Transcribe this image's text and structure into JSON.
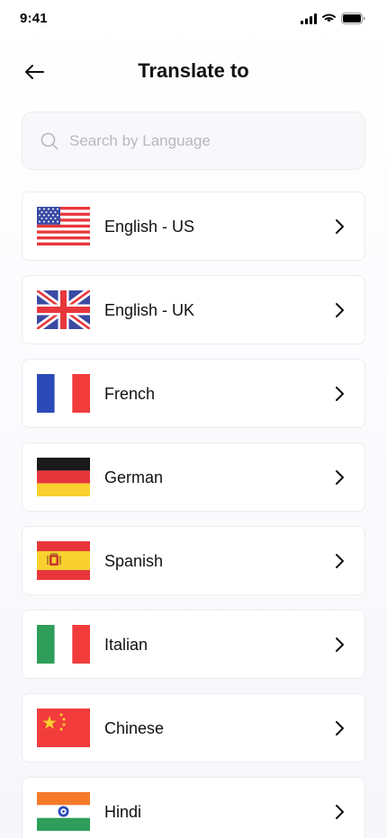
{
  "status_bar": {
    "time": "9:41",
    "icons": [
      "signal-icon",
      "wifi-icon",
      "battery-icon"
    ]
  },
  "header": {
    "title": "Translate to",
    "back_icon": "arrow-left-icon"
  },
  "search": {
    "placeholder": "Search by Language",
    "value": "",
    "icon": "search-icon"
  },
  "languages": [
    {
      "label": "English - US",
      "flag": "us-flag-icon"
    },
    {
      "label": "English - UK",
      "flag": "uk-flag-icon"
    },
    {
      "label": "French",
      "flag": "france-flag-icon"
    },
    {
      "label": "German",
      "flag": "germany-flag-icon"
    },
    {
      "label": "Spanish",
      "flag": "spain-flag-icon"
    },
    {
      "label": "Italian",
      "flag": "italy-flag-icon"
    },
    {
      "label": "Chinese",
      "flag": "china-flag-icon"
    },
    {
      "label": "Hindi",
      "flag": "india-flag-icon"
    }
  ],
  "colors": {
    "background": "#ffffff",
    "card_border": "#ececf0",
    "search_bg": "#f8f8fa",
    "placeholder": "#b8b8be",
    "text": "#111111"
  }
}
